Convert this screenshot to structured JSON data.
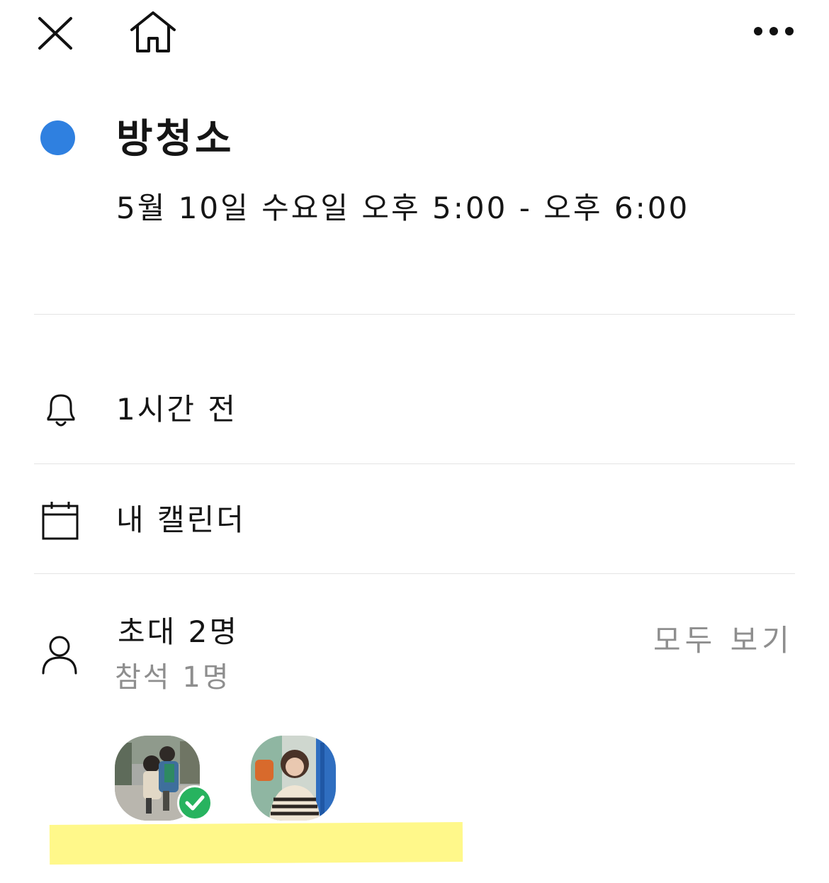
{
  "toolbar": {
    "close_icon": "close-icon",
    "home_icon": "home-icon",
    "more_icon": "more-horizontal-icon"
  },
  "event": {
    "color": "#2f80e0",
    "title": "방청소",
    "datetime": "5월 10일 수요일 오후 5:00 - 오후 6:00"
  },
  "reminder": {
    "icon": "bell-icon",
    "label": "1시간 전"
  },
  "calendar": {
    "icon": "calendar-icon",
    "label": "내 캘린더"
  },
  "attendees": {
    "icon": "person-icon",
    "invited_label": "초대 2명",
    "accepted_label": "참석 1명",
    "see_all_label": "모두 보기",
    "people": [
      {
        "avatar": "children-photo",
        "accepted": true,
        "badge_color": "#27b35f"
      },
      {
        "avatar": "woman-photo",
        "accepted": false
      }
    ]
  },
  "highlight_color": "#fff88a"
}
